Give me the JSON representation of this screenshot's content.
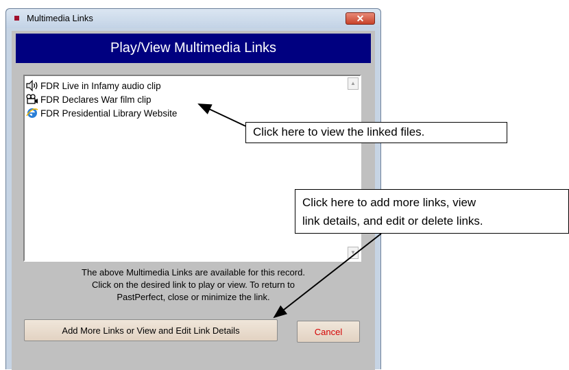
{
  "window": {
    "title": "Multimedia Links",
    "close_glyph": "✕"
  },
  "banner": {
    "title": "Play/View Multimedia Links"
  },
  "links": [
    {
      "label": "FDR Live in Infamy audio clip",
      "icon": "speaker-icon"
    },
    {
      "label": "FDR Declares War film clip",
      "icon": "film-camera-icon"
    },
    {
      "label": "FDR Presidential Library Website",
      "icon": "internet-explorer-icon"
    }
  ],
  "info": {
    "line1": "The above Multimedia Links are available for this record.",
    "line2": "Click on the desired link to play or view.  To return to",
    "line3": "PastPerfect, close or minimize the link."
  },
  "buttons": {
    "add_label": "Add More Links or View and Edit Link Details",
    "cancel_label": "Cancel"
  },
  "callouts": {
    "view": "Click here to view the linked files.",
    "add_line1": "Click here to add more links, view",
    "add_line2": "link details, and edit or delete links."
  },
  "colors": {
    "banner_bg": "#000080",
    "client_bg": "#c0c0c0",
    "cancel_text": "#d40000",
    "title_icon": "#a0102c"
  }
}
